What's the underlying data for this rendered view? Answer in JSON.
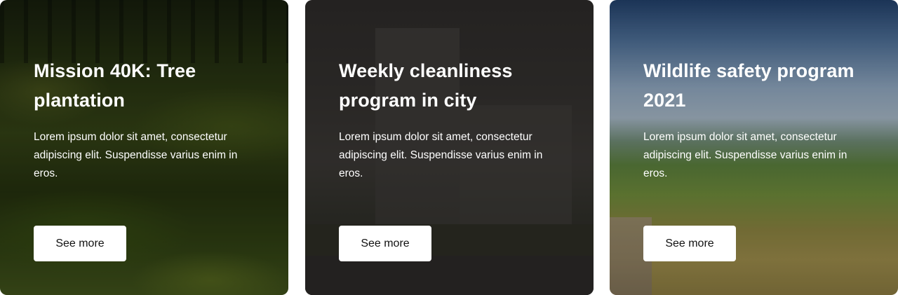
{
  "cards": [
    {
      "title": "Mission 40K: Tree plantation",
      "description": "Lorem ipsum dolor sit amet, consectetur adipiscing elit. Suspendisse varius enim in eros.",
      "button_label": "See more"
    },
    {
      "title": "Weekly cleanliness program in city",
      "description": "Lorem ipsum dolor sit amet, consectetur adipiscing elit. Suspendisse varius enim in eros.",
      "button_label": "See more"
    },
    {
      "title": "Wildlife safety program 2021",
      "description": "Lorem ipsum dolor sit amet, consectetur adipiscing elit. Suspendisse varius enim in eros.",
      "button_label": "See more"
    }
  ],
  "colors": {
    "text": "#ffffff",
    "button_bg": "#ffffff",
    "button_text": "#111111"
  }
}
